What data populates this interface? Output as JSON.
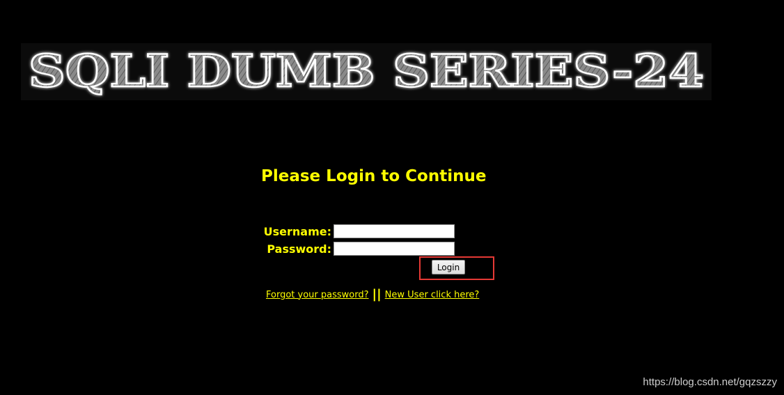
{
  "banner": {
    "text": "SQLI DUMB SERIES-24"
  },
  "login": {
    "title": "Please Login to Continue",
    "username_label": "Username:",
    "username_value": "",
    "password_label": "Password:",
    "password_value": "",
    "login_button": "Login"
  },
  "links": {
    "forgot": "Forgot your password?",
    "separator": "||",
    "new_user": "New User click here?"
  },
  "watermark": "https://blog.csdn.net/gqzszzy",
  "colors": {
    "background": "#000000",
    "text_accent": "#ffff00",
    "highlight_box": "#e53935"
  }
}
